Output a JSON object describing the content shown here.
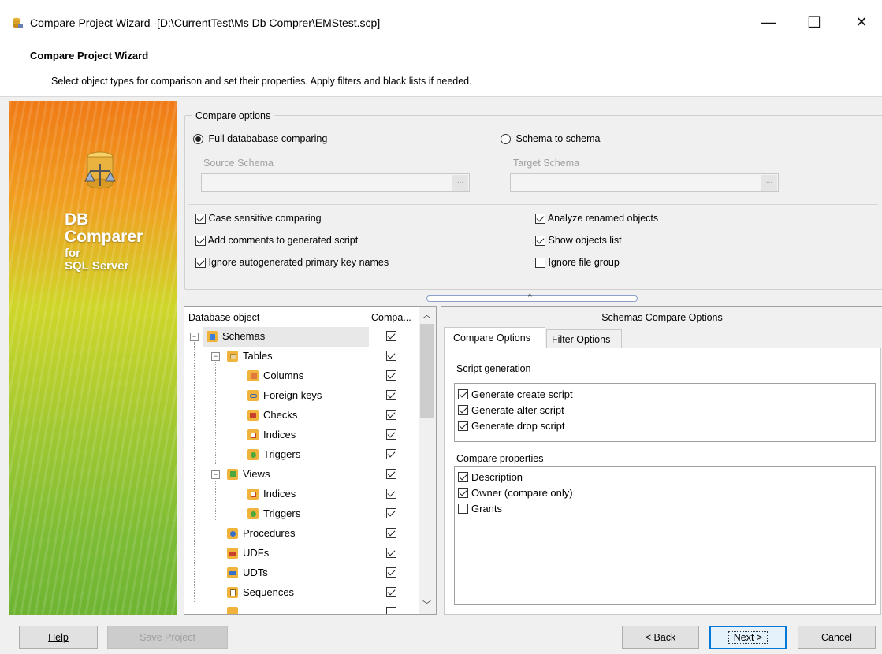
{
  "window": {
    "title": "Compare Project Wizard -[D:\\CurrentTest\\Ms Db Comprer\\EMStest.scp]",
    "minimize": "—",
    "maximize": "☐",
    "close": "✕"
  },
  "header": {
    "title": "Compare Project Wizard",
    "subtitle": "Select object types for comparison and set their properties. Apply filters and black lists if needed."
  },
  "banner": {
    "line1": "DB",
    "line2": "Comparer",
    "line3": "for",
    "line4": "SQL Server"
  },
  "compare_options": {
    "legend": "Compare options",
    "radio_full": "Full datababase comparing",
    "radio_schema": "Schema to schema",
    "source_schema_label": "Source Schema",
    "target_schema_label": "Target Schema",
    "combo_btn": "...",
    "checks": [
      {
        "label": "Case sensitive comparing",
        "checked": true
      },
      {
        "label": "Add comments to generated script",
        "checked": true
      },
      {
        "label": "Ignore autogenerated primary key names",
        "checked": true
      },
      {
        "label": "Analyze renamed objects",
        "checked": true
      },
      {
        "label": "Show objects list",
        "checked": true
      },
      {
        "label": "Ignore file group",
        "checked": false
      }
    ]
  },
  "tree": {
    "col_object": "Database object",
    "col_compare": "Compa...",
    "items": [
      {
        "label": "Schemas",
        "level": 0,
        "icon": "schema-icon",
        "checked": true
      },
      {
        "label": "Tables",
        "level": 1,
        "icon": "table-icon",
        "checked": true
      },
      {
        "label": "Columns",
        "level": 2,
        "icon": "columns-icon",
        "checked": true
      },
      {
        "label": "Foreign keys",
        "level": 2,
        "icon": "foreign-key-icon",
        "checked": true
      },
      {
        "label": "Checks",
        "level": 2,
        "icon": "check-constraint-icon",
        "checked": true
      },
      {
        "label": "Indices",
        "level": 2,
        "icon": "index-icon",
        "checked": true
      },
      {
        "label": "Triggers",
        "level": 2,
        "icon": "trigger-icon",
        "checked": true
      },
      {
        "label": "Views",
        "level": 1,
        "icon": "view-icon",
        "checked": true
      },
      {
        "label": "Indices",
        "level": 2,
        "icon": "index-icon",
        "checked": true
      },
      {
        "label": "Triggers",
        "level": 2,
        "icon": "trigger-icon",
        "checked": true
      },
      {
        "label": "Procedures",
        "level": 1,
        "icon": "procedure-icon",
        "checked": true
      },
      {
        "label": "UDFs",
        "level": 1,
        "icon": "udf-icon",
        "checked": true
      },
      {
        "label": "UDTs",
        "level": 1,
        "icon": "udt-icon",
        "checked": true
      },
      {
        "label": "Sequences",
        "level": 1,
        "icon": "sequence-icon",
        "checked": true
      }
    ]
  },
  "right_panel": {
    "title": "Schemas Compare Options",
    "tab_compare": "Compare Options",
    "tab_filter": "Filter Options",
    "script_generation_label": "Script generation",
    "script_items": [
      {
        "label": "Generate create script",
        "checked": true
      },
      {
        "label": "Generate alter script",
        "checked": true
      },
      {
        "label": "Generate drop script",
        "checked": true
      }
    ],
    "compare_properties_label": "Compare properties",
    "property_items": [
      {
        "label": "Description",
        "checked": true
      },
      {
        "label": "Owner (compare only)",
        "checked": true
      },
      {
        "label": "Grants",
        "checked": false
      }
    ]
  },
  "buttons": {
    "help": "Help",
    "save_project": "Save Project",
    "back": "< Back",
    "next": "Next >",
    "cancel": "Cancel"
  }
}
